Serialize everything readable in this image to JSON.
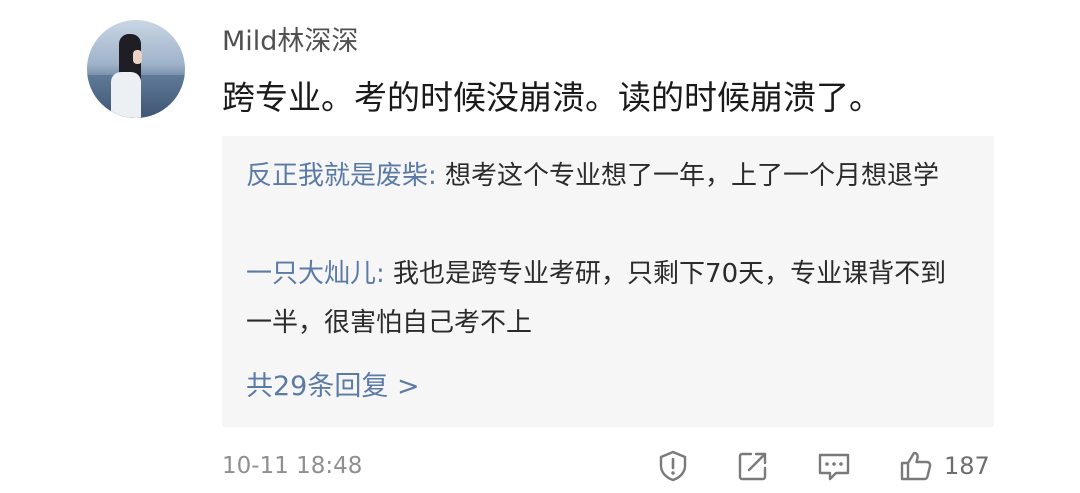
{
  "comment": {
    "username": "Mild林深深",
    "text": "跨专业。考的时候没崩溃。读的时候崩溃了。",
    "timestamp": "10-11 18:48",
    "like_count": "187"
  },
  "replies": [
    {
      "author": "反正我就是废柴:",
      "text": " 想考这个专业想了一年，上了一个月想退学"
    },
    {
      "author": "一只大灿儿:",
      "text": " 我也是跨专业考研，只剩下70天，专业课背不到一半，很害怕自己考不上"
    }
  ],
  "more_replies_label": "共29条回复 >",
  "icons": {
    "report": "report-icon",
    "repost": "repost-icon",
    "comment": "comment-icon",
    "like": "like-icon"
  },
  "colors": {
    "link": "#5b7ba6",
    "reply_background": "#f6f6f7",
    "icon": "#7a7a7a"
  }
}
